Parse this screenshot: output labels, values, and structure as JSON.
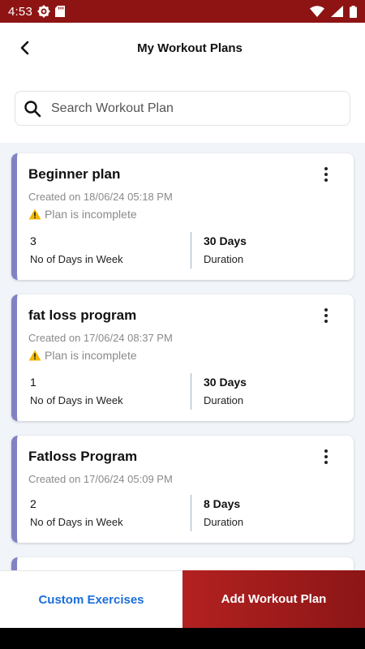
{
  "status_bar": {
    "time": "4:53",
    "icons": [
      "gear-icon",
      "sd-card-icon",
      "wifi-icon",
      "signal-icon",
      "battery-icon"
    ]
  },
  "header": {
    "title": "My Workout Plans",
    "back_icon": "chevron-left-icon"
  },
  "search": {
    "placeholder": "Search Workout Plan",
    "value": "",
    "icon": "search-icon"
  },
  "plans": [
    {
      "name": "Beginner plan",
      "created": "Created on 18/06/24 05:18 PM",
      "warning": "Plan is incomplete",
      "days_in_week": "3",
      "days_in_week_label": "No of Days in Week",
      "duration": "30 Days",
      "duration_label": "Duration"
    },
    {
      "name": "fat loss program",
      "created": "Created on 17/06/24 08:37 PM",
      "warning": "Plan is incomplete",
      "days_in_week": "1",
      "days_in_week_label": "No of Days in Week",
      "duration": "30 Days",
      "duration_label": "Duration"
    },
    {
      "name": "Fatloss Program",
      "created": "Created on 17/06/24 05:09 PM",
      "warning": "",
      "days_in_week": "2",
      "days_in_week_label": "No of Days in Week",
      "duration": "8 Days",
      "duration_label": "Duration"
    }
  ],
  "footer": {
    "custom_label": "Custom Exercises",
    "add_label": "Add Workout Plan"
  },
  "colors": {
    "status_bar": "#8e1414",
    "accent_red": "#a01c1c",
    "link_blue": "#1b6fd8",
    "card_border": "#8182c4",
    "list_bg": "#f1f4f9"
  }
}
